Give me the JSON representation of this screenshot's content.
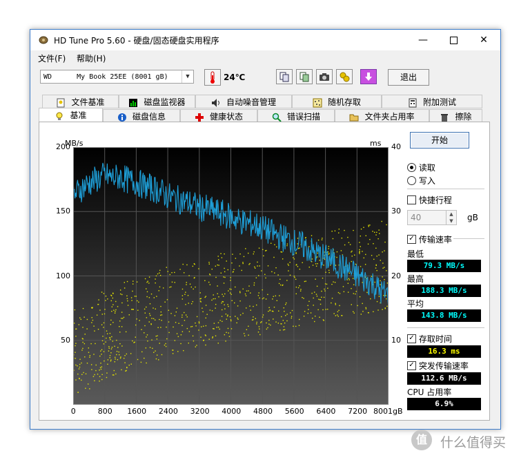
{
  "window": {
    "title": "HD Tune Pro 5.60 - 硬盘/固态硬盘实用程序"
  },
  "menu": {
    "file": "文件(F)",
    "help": "帮助(H)"
  },
  "toolbar": {
    "drive": "WD      My Book 25EE (8001 gB)",
    "temperature": "24℃",
    "exit_label": "退出"
  },
  "tabs_top": [
    "文件基准",
    "磁盘监视器",
    "自动噪音管理",
    "随机存取",
    "附加测试"
  ],
  "tabs_bottom": [
    "基准",
    "磁盘信息",
    "健康状态",
    "错误扫描",
    "文件夹占用率",
    "擦除"
  ],
  "side": {
    "start_label": "开始",
    "read_label": "读取",
    "write_label": "写入",
    "quick_label": "快捷行程",
    "quick_value": "40",
    "quick_unit": "gB",
    "transfer_label": "传输速率",
    "min_label": "最低",
    "min_value": "79.3 MB/s",
    "max_label": "最高",
    "max_value": "188.3 MB/s",
    "avg_label": "平均",
    "avg_value": "143.8 MB/s",
    "access_label": "存取时间",
    "access_value": "16.3 ms",
    "burst_label": "突发传输速率",
    "burst_value": "112.6 MB/s",
    "cpu_label": "CPU 占用率",
    "cpu_value": "6.9%"
  },
  "watermark": "值 什么值得买",
  "chart_data": {
    "type": "line",
    "ylabel": "MB/s",
    "y2label": "ms",
    "ylim": [
      0,
      200
    ],
    "y2lim": [
      0,
      40
    ],
    "yticks": [
      50,
      100,
      150,
      200
    ],
    "y2ticks": [
      10,
      20,
      30,
      40
    ],
    "xlim": [
      0,
      8001
    ],
    "xticks": [
      "0",
      "800",
      "1600",
      "2400",
      "3200",
      "4000",
      "4800",
      "5600",
      "6400",
      "7200",
      "8001gB"
    ],
    "series": [
      {
        "kind": "transfer",
        "color": "#1e9fd8",
        "x": [
          0,
          200,
          400,
          600,
          800,
          1000,
          1200,
          1400,
          1600,
          1800,
          2000,
          2200,
          2400,
          2600,
          2800,
          3000,
          3200,
          3400,
          3600,
          3800,
          4000,
          4200,
          4400,
          4600,
          4800,
          5000,
          5200,
          5400,
          5600,
          5800,
          6000,
          6200,
          6400,
          6600,
          6800,
          7000,
          7200,
          7400,
          7600,
          7800,
          8001
        ],
        "values": [
          162,
          168,
          172,
          175,
          178,
          176,
          177,
          174,
          173,
          170,
          168,
          166,
          162,
          160,
          158,
          156,
          153,
          152,
          150,
          148,
          146,
          143,
          141,
          140,
          137,
          134,
          131,
          129,
          126,
          124,
          120,
          117,
          114,
          111,
          107,
          104,
          100,
          97,
          94,
          88,
          85
        ]
      },
      {
        "kind": "access",
        "color": "#e6e600",
        "x": [
          0,
          800,
          1600,
          2400,
          3200,
          4000,
          4800,
          5600,
          6400,
          7200,
          8001
        ],
        "values": [
          8,
          11,
          13,
          14.5,
          16,
          17,
          18,
          19,
          20,
          21,
          22
        ]
      }
    ]
  }
}
